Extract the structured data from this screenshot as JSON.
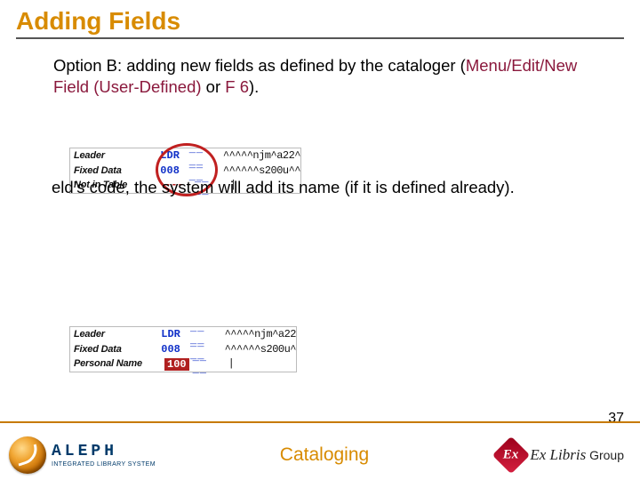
{
  "title": "Adding Fields",
  "para1_a": "Option B: adding new fields as defined by the cataloger (",
  "para1_b": "Menu/Edit/New Field (User-Defined)",
  "para1_c": " or ",
  "para1_d": "F 6",
  "para1_e": ").",
  "shot1": {
    "rows": [
      {
        "label": "Leader",
        "code": "LDR",
        "codeClass": "blue",
        "ind": "__ __",
        "val": "^^^^^njm^a22^"
      },
      {
        "label": "Fixed Data",
        "code": "008",
        "codeClass": "blue",
        "ind": "__ __",
        "val": "^^^^^^s200u^^"
      },
      {
        "label": "Not in Table",
        "code": "---",
        "codeClass": "red",
        "ind": "__ __",
        "val": "|"
      }
    ]
  },
  "midline_tail": "eld's code, the system will add its name (if it is defined already).",
  "shot2": {
    "rows": [
      {
        "label": "Leader",
        "code": "LDR",
        "codeClass": "blue",
        "ind": "__ __",
        "val": "^^^^^njm^a22"
      },
      {
        "label": "Fixed Data",
        "code": "008",
        "codeClass": "blue",
        "ind": "__ __",
        "val": "^^^^^^s200u^"
      },
      {
        "label": "Personal Name",
        "code": "100",
        "codeClass": "red-inv",
        "ind": "__ __",
        "val": "|"
      }
    ]
  },
  "page_number": "37",
  "footer": {
    "brand": "ALEPH",
    "brand_sub": "INTEGRATED LIBRARY SYSTEM",
    "mid": "Cataloging",
    "ex_abbrev": "Ex",
    "ex_name": "Ex Libris",
    "ex_group": " Group"
  }
}
